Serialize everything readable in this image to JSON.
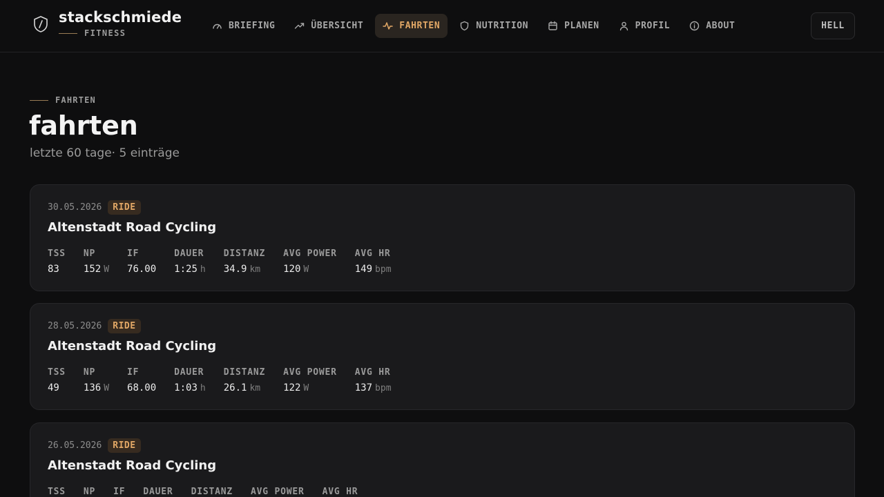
{
  "brand": {
    "name": "stackschmiede",
    "subtitle": "FITNESS"
  },
  "nav": {
    "items": [
      {
        "label": "BRIEFING",
        "icon": "gauge-icon",
        "active": false
      },
      {
        "label": "ÜBERSICHT",
        "icon": "trending-up-icon",
        "active": false
      },
      {
        "label": "FAHRTEN",
        "icon": "activity-icon",
        "active": true
      },
      {
        "label": "NUTRITION",
        "icon": "shield-icon",
        "active": false
      },
      {
        "label": "PLANEN",
        "icon": "calendar-icon",
        "active": false
      },
      {
        "label": "PROFIL",
        "icon": "user-icon",
        "active": false
      },
      {
        "label": "ABOUT",
        "icon": "info-icon",
        "active": false
      }
    ],
    "theme_label": "HELL"
  },
  "page": {
    "eyebrow": "FAHRTEN",
    "title": "fahrten",
    "meta": "letzte 60 tage· 5 einträge"
  },
  "stat_labels": {
    "tss": "TSS",
    "np": "NP",
    "if": "IF",
    "dauer": "DAUER",
    "distanz": "DISTANZ",
    "avg_power": "AVG POWER",
    "avg_hr": "AVG HR"
  },
  "units": {
    "np": "W",
    "dauer": "h",
    "distanz": "km",
    "avg_power": "W",
    "avg_hr": "bpm"
  },
  "rides": [
    {
      "date": "30.05.2026",
      "type": "RIDE",
      "name": "Altenstadt Road Cycling",
      "tss": "83",
      "np": "152",
      "if": "76.00",
      "dauer": "1:25",
      "distanz": "34.9",
      "avg_power": "120",
      "avg_hr": "149"
    },
    {
      "date": "28.05.2026",
      "type": "RIDE",
      "name": "Altenstadt Road Cycling",
      "tss": "49",
      "np": "136",
      "if": "68.00",
      "dauer": "1:03",
      "distanz": "26.1",
      "avg_power": "122",
      "avg_hr": "137"
    },
    {
      "date": "26.05.2026",
      "type": "RIDE",
      "name": "Altenstadt Road Cycling",
      "tss": "",
      "np": "",
      "if": "",
      "dauer": "",
      "distanz": "",
      "avg_power": "",
      "avg_hr": ""
    }
  ],
  "colors": {
    "accent": "#e2a866",
    "background": "#0e0e0f",
    "card": "#1a1a1c"
  }
}
